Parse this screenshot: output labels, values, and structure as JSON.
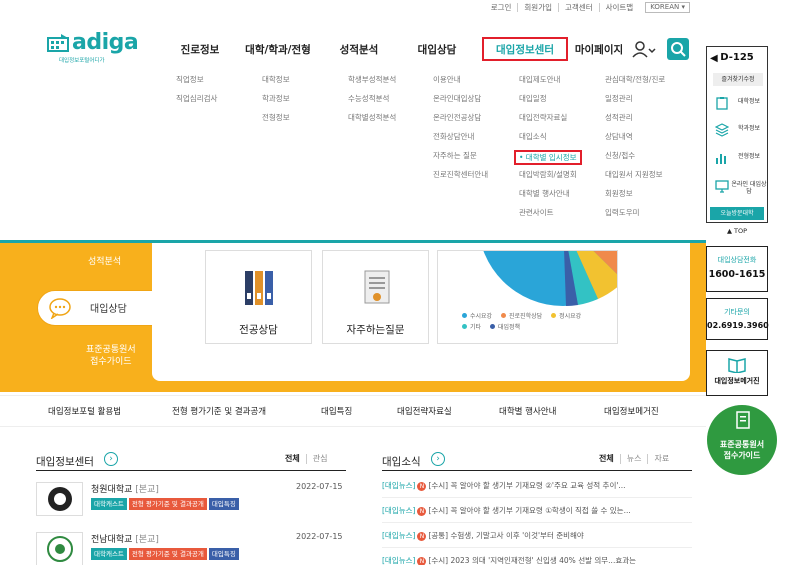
{
  "util": {
    "links": [
      "로그인",
      "회원가입",
      "고객센터",
      "사이트맵"
    ],
    "lang": "KOREAN"
  },
  "logo": {
    "name": "adiga",
    "subtitle": "대입정보포털어디가"
  },
  "gnb": [
    "진로정보",
    "대학/학과/전형",
    "성적분석",
    "대입상담",
    "대입정보센터",
    "마이페이지"
  ],
  "dropdown": {
    "col1": [
      "직업정보",
      "직업심리검사"
    ],
    "col2": [
      "대학정보",
      "학과정보",
      "전형정보"
    ],
    "col3": [
      "학생부성적분석",
      "수능성적분석",
      "대학별성적분석"
    ],
    "col4": [
      "이용안내",
      "온라인대입상담",
      "온라인전공상담",
      "전화상담안내",
      "자주하는 질문",
      "진로진학센터안내"
    ],
    "col5": [
      "대입제도안내",
      "대입일정",
      "대입전략자료실",
      "대입소식",
      "• 대학별 입시정보",
      "대입박람회/설명회",
      "대학별 행사안내",
      "관련사이트"
    ],
    "col6": [
      "관심대학/전형/진로",
      "일정관리",
      "성적관리",
      "상담내역",
      "신청/접수",
      "대입원서 지원정보",
      "회원정보",
      "입력도우미"
    ]
  },
  "orange": {
    "menu_top": "성적분석",
    "pill": "대입상담",
    "guide": [
      "표준공통원서",
      "접수가이드"
    ]
  },
  "cards": [
    "전공상담",
    "자주하는질문"
  ],
  "legend": [
    {
      "label": "수시요강",
      "color": "#2aa5d8"
    },
    {
      "label": "진로진학상담",
      "color": "#f08a4b"
    },
    {
      "label": "정시요강",
      "color": "#f2c230"
    },
    {
      "label": "기타",
      "color": "#33c2c4"
    },
    {
      "label": "대입정책",
      "color": "#3a5fa8"
    }
  ],
  "linkbar": [
    "대입정보포털 활용법",
    "전형 평가기준 및 결과공개",
    "대입특징",
    "대입전략자료실",
    "대학별 행사안내",
    "대입정보메거진"
  ],
  "board1": {
    "title": "대입정보센터",
    "tabs": [
      "전체",
      "관심"
    ],
    "rows": [
      {
        "name": "청원대학교",
        "campus": "[본교]",
        "date": "2022-07-15",
        "tags": [
          "대학캐스트",
          "전형 평가기준 및 결과공개",
          "대입특징"
        ]
      },
      {
        "name": "전남대학교",
        "campus": "[본교]",
        "date": "2022-07-15",
        "tags": [
          "대학캐스트",
          "전형 평가기준 및 결과공개",
          "대입특징"
        ]
      }
    ]
  },
  "board2": {
    "title": "대입소식",
    "tabs": [
      "전체",
      "뉴스",
      "자료"
    ],
    "items": [
      {
        "cat": "[대입뉴스]",
        "text": "[수시] 꼭 알아야 할 생기부 기재요령 ②'주요 교육 성적 추이'..."
      },
      {
        "cat": "[대입뉴스]",
        "text": "[수시] 꼭 알아야 할 생기부 기재요령 ①학생이 직접 쓸 수 있는..."
      },
      {
        "cat": "[대입뉴스]",
        "text": "[공통] 수험생, 기말고사 이후 '이것'부터 준비해야"
      },
      {
        "cat": "[대입뉴스]",
        "text": "[수시] 2023 의대 '지역인재전형' 신입생 40% 선발 의무...효과는"
      }
    ]
  },
  "quick": {
    "dday": "D-125",
    "fav": "즐겨찾기수정",
    "items": [
      "대학정보",
      "학과정보",
      "전형정보",
      "온라인 대입상담"
    ],
    "visit": "오늘방문대학",
    "top": "TOP",
    "call_label": "대입상담전화",
    "call_number": "1600-1615",
    "inq_label": "기타문의",
    "inq_number": "02.6919.3960",
    "magazine": "대입정보메거진",
    "green": [
      "표준공통원서",
      "접수가이드"
    ]
  }
}
